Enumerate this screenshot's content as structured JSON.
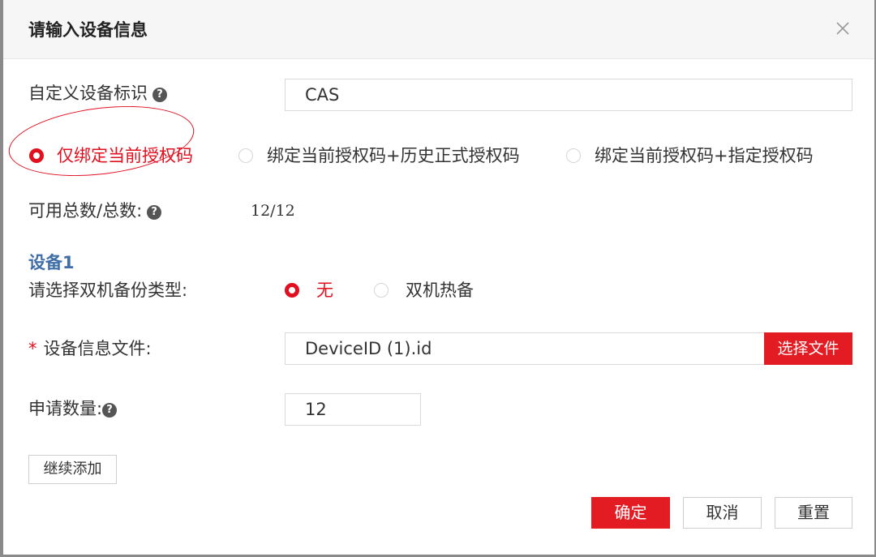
{
  "dialog": {
    "title": "请输入设备信息",
    "close_icon": "close-icon"
  },
  "custom_id": {
    "label": "自定义设备标识",
    "value": "CAS"
  },
  "bind_options": [
    {
      "label": "仅绑定当前授权码",
      "selected": true
    },
    {
      "label": "绑定当前授权码+历史正式授权码",
      "selected": false
    },
    {
      "label": "绑定当前授权码+指定授权码",
      "selected": false
    }
  ],
  "availability": {
    "label": "可用总数/总数:",
    "value": "12/12"
  },
  "device": {
    "section_title": "设备1",
    "backup_label": "请选择双机备份类型:",
    "backup_options": [
      {
        "label": "无",
        "selected": true
      },
      {
        "label": "双机热备",
        "selected": false
      }
    ],
    "required_mark": "*",
    "file_label": "设备信息文件:",
    "file_value": "DeviceID (1).id",
    "choose_file_label": "选择文件",
    "quantity_label": "申请数量:",
    "quantity_value": "12"
  },
  "actions": {
    "add_more": "继续添加",
    "confirm": "确定",
    "cancel": "取消",
    "reset": "重置"
  },
  "colors": {
    "accent_red": "#e31b23",
    "section_blue": "#3f6ea8"
  }
}
